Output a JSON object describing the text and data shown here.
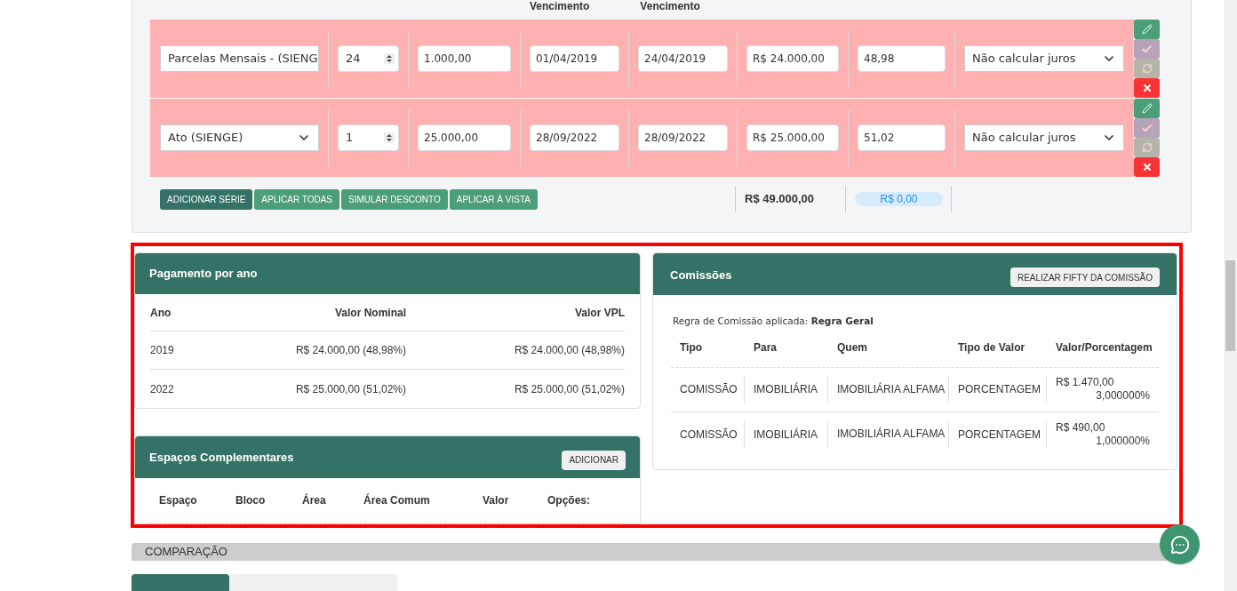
{
  "installments": {
    "column_headers": [
      {
        "label": "Vencimento"
      },
      {
        "label": "Vencimento"
      }
    ],
    "rows": [
      {
        "series": "Parcelas Mensais - (SIENG",
        "quantity": "24",
        "value": "1.000,00",
        "first_due": "01/04/2019",
        "last_due": "24/04/2019",
        "total": "R$ 24.000,00",
        "percent": "48,98",
        "interest": "Não calcular juros",
        "actions": [
          {
            "kind": "edit",
            "disabled": false
          },
          {
            "kind": "confirm",
            "disabled": true
          },
          {
            "kind": "refresh",
            "disabled": true
          },
          {
            "kind": "delete",
            "disabled": false
          }
        ]
      },
      {
        "series": "Ato (SIENGE)",
        "quantity": "1",
        "value": "25.000,00",
        "first_due": "28/09/2022",
        "last_due": "28/09/2022",
        "total": "R$ 25.000,00",
        "percent": "51,02",
        "interest": "Não calcular juros",
        "actions": [
          {
            "kind": "edit",
            "disabled": false
          },
          {
            "kind": "confirm",
            "disabled": true
          },
          {
            "kind": "refresh",
            "disabled": true
          },
          {
            "kind": "delete",
            "disabled": false
          }
        ]
      }
    ],
    "buttons": [
      {
        "label": "ADICIONAR SÉRIE",
        "kind": "dark"
      },
      {
        "label": "APLICAR TODAS",
        "kind": "light"
      },
      {
        "label": "SIMULAR DESCONTO",
        "kind": "light"
      },
      {
        "label": "APLICAR À VISTA",
        "kind": "light"
      }
    ],
    "sum_total": "R$ 49.000,00",
    "difference": "R$ 0,00"
  },
  "payment_by_year": {
    "title": "Pagamento por ano",
    "columns": [
      "Ano",
      "Valor Nominal",
      "Valor VPL"
    ],
    "rows": [
      [
        "2019",
        "R$ 24.000,00 (48,98%)",
        "R$ 24.000,00 (48,98%)"
      ],
      [
        "2022",
        "R$ 25.000,00 (51,02%)",
        "R$ 25.000,00 (51,02%)"
      ]
    ]
  },
  "extra_spaces": {
    "title": "Espaços Complementares",
    "button": "ADICIONAR",
    "columns": [
      "Espaço",
      "Bloco",
      "Área",
      "Área Comum",
      "Valor",
      "Opções:"
    ]
  },
  "commissions": {
    "title": "Comissões",
    "button": "REALIZAR FIFTY DA COMISSÃO",
    "rule": "Regra de Comissão aplicada: **Regra Geral**",
    "columns": [
      "Tipo",
      "Para",
      "Quem",
      "Tipo de Valor",
      "Valor/Porcentagem"
    ],
    "rows": [
      {
        "tipo": "COMISSÃO",
        "para": "IMOBILIÁRIA",
        "quem": "IMOBILIÁRIA ALFAMA",
        "tipo_valor": "PORCENTAGEM",
        "valor": "R$ 1.470,00",
        "porcentagem": "3,000000%"
      },
      {
        "tipo": "COMISSÃO",
        "para": "IMOBILIÁRIA",
        "quem": "IMOBILIÁRIA ALFAMA",
        "tipo_valor": "PORCENTAGEM",
        "valor": "R$ 490,00",
        "porcentagem": "1,000000%"
      }
    ]
  },
  "comparison": {
    "title": "COMPARAÇÃO",
    "tabs": [
      {
        "selected": true
      },
      {
        "selected": false
      }
    ]
  }
}
